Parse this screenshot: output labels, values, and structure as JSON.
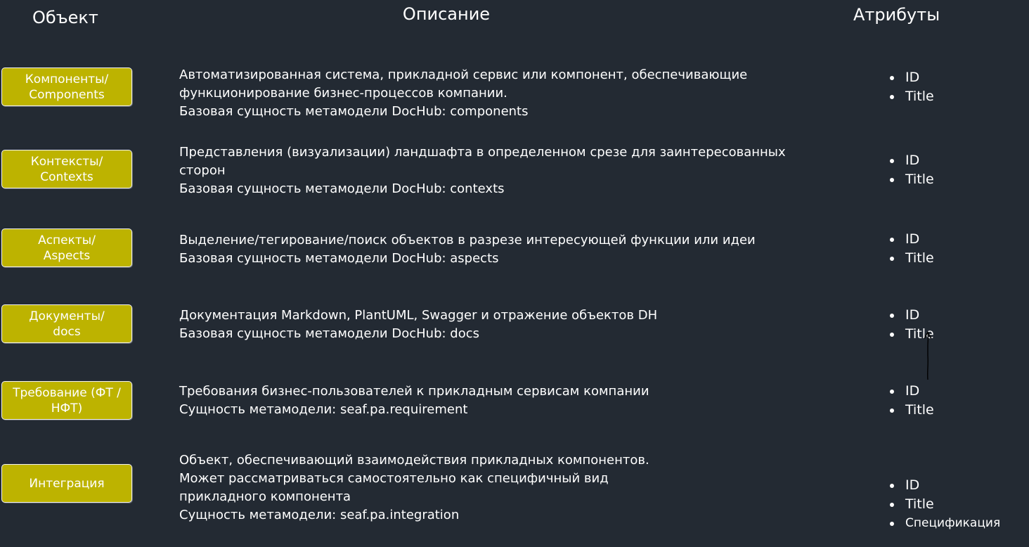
{
  "headers": {
    "object": "Объект",
    "description": "Описание",
    "attributes": "Атрибуты"
  },
  "rows": [
    {
      "object": "Компоненты/\nComponents",
      "description": [
        "Автоматизированная система, прикладной сервис или компонент, обеспечивающие",
        "функционирование бизнес-процессов компании.",
        "Базовая сущность метамодели DocHub: components"
      ],
      "attributes": [
        "ID",
        "Title"
      ]
    },
    {
      "object": "Контексты/\nContexts",
      "description": [
        "Представления (визуализации) ландшафта в определенном срезе для заинтересованных",
        "сторон",
        "Базовая сущность метамодели DocHub: contexts"
      ],
      "attributes": [
        "ID",
        "Title"
      ]
    },
    {
      "object": "Аспекты/\nAspects",
      "description": [
        "Выделение/тегирование/поиск объектов в разрезе интересующей функции или идеи",
        "Базовая сущность метамодели DocHub: aspects"
      ],
      "attributes": [
        "ID",
        "Title"
      ]
    },
    {
      "object": "Документы/\ndocs",
      "description": [
        "Документация Markdown, PlantUML, Swagger и отражение объектов DH",
        "Базовая сущность метамодели DocHub: docs"
      ],
      "attributes": [
        "ID",
        "Title"
      ]
    },
    {
      "object": "Требование (ФТ /\nНФТ)",
      "description": [
        "Требования бизнес-пользователей к прикладным сервисам компании",
        "Сущность метамодели: seaf.pa.requirement"
      ],
      "attributes": [
        "ID",
        "Title"
      ]
    },
    {
      "object": "Интеграция",
      "description": [
        "Объект, обеспечивающий взаимодействия прикладных компонентов.",
        "Может рассматриваться самостоятельно как специфичный вид",
        "прикладного компонента",
        "Сущность метамодели: seaf.pa.integration"
      ],
      "attributes": [
        "ID",
        "Title",
        "Спецификация"
      ]
    }
  ],
  "colors": {
    "background": "#232a33",
    "object_box": "#bdb300",
    "text": "#ffffff"
  }
}
